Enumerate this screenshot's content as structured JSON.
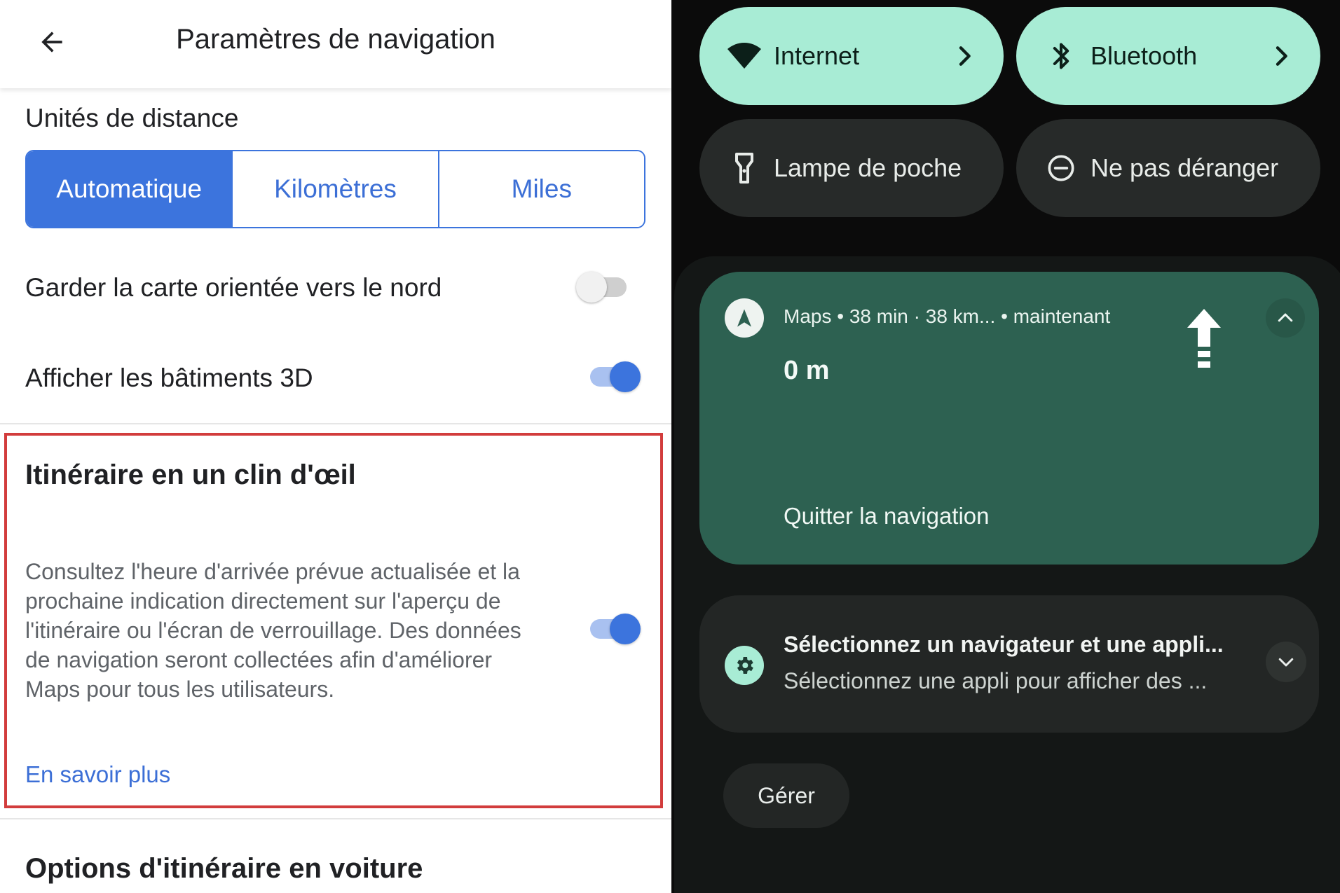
{
  "settings": {
    "title": "Paramètres de navigation",
    "distance_units": {
      "label": "Unités de distance",
      "options": [
        "Automatique",
        "Kilomètres",
        "Miles"
      ],
      "selected": "Automatique"
    },
    "north_up": {
      "label": "Garder la carte orientée vers le nord",
      "enabled": false
    },
    "buildings_3d": {
      "label": "Afficher les bâtiments 3D",
      "enabled": true
    },
    "glanceable": {
      "title": "Itinéraire en un clin d'œil",
      "description": "Consultez l'heure d'arrivée prévue actualisée et la prochaine indication directement sur l'aperçu de l'itinéraire ou l'écran de verrouillage. Des données de navigation seront collectées afin d'améliorer Maps pour tous les utilisateurs.",
      "enabled": true,
      "link": "En savoir plus"
    },
    "driving_options": {
      "title": "Options d'itinéraire en voiture"
    },
    "colors": {
      "accent": "#3c74dd",
      "highlight_border": "#d23c3c"
    }
  },
  "quick_settings": {
    "tiles": [
      {
        "label": "Internet",
        "icon": "wifi-icon",
        "active": true,
        "has_chevron": true
      },
      {
        "label": "Bluetooth",
        "icon": "bluetooth-icon",
        "active": true,
        "has_chevron": true
      },
      {
        "label": "Lampe de poche",
        "icon": "flashlight-icon",
        "active": false,
        "has_chevron": false
      },
      {
        "label": "Ne pas déranger",
        "icon": "do-not-disturb-icon",
        "active": false,
        "has_chevron": false
      }
    ],
    "colors": {
      "active_tile": "#a8ecd5",
      "inactive_tile": "#272a29"
    }
  },
  "notifications": {
    "navigation": {
      "app": "Maps",
      "meta": "Maps • 38 min · 38 km...  • maintenant",
      "distance": "0 m",
      "action": "Quitter la navigation",
      "color": "#2d6151"
    },
    "system": {
      "title": "Sélectionnez un navigateur et une appli...",
      "text": "Sélectionnez une appli pour afficher des ..."
    },
    "manage_label": "Gérer"
  }
}
